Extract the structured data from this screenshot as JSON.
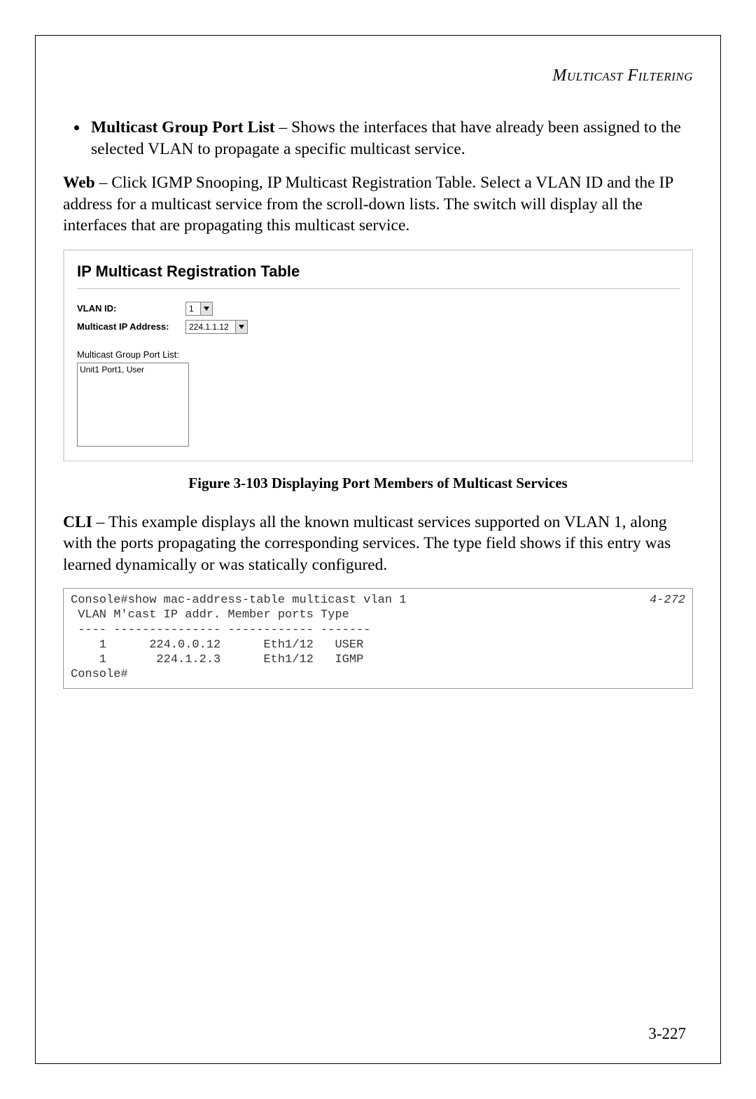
{
  "header": {
    "section_title": "Multicast Filtering"
  },
  "bullet": {
    "term": "Multicast Group Port List",
    "desc": " – Shows the interfaces that have already been assigned to the selected VLAN to propagate a specific multicast service."
  },
  "web_para": {
    "lead": "Web",
    "rest": " – Click IGMP Snooping, IP Multicast Registration Table. Select a VLAN ID and the IP address for a multicast service from the scroll-down lists. The switch will display all the interfaces that are propagating this multicast service."
  },
  "ui": {
    "title": "IP Multicast Registration Table",
    "vlan_label": "VLAN ID:",
    "vlan_value": "1",
    "ip_label": "Multicast IP Address:",
    "ip_value": "224.1.1.12",
    "portlist_label": "Multicast Group Port List:",
    "portlist_item": "Unit1 Port1, User"
  },
  "figure_caption": "Figure 3-103  Displaying Port Members of Multicast Services",
  "cli_para": {
    "lead": "CLI",
    "rest": " – This example displays all the known multicast services supported on VLAN 1, along with the ports propagating the corresponding services. The type field shows if this entry was learned dynamically or was statically configured."
  },
  "cli": {
    "ref": "4-272",
    "line1": "Console#show mac-address-table multicast vlan 1",
    "line2": " VLAN M'cast IP addr. Member ports Type",
    "line3": " ---- --------------- ------------ -------",
    "line4": "    1      224.0.0.12      Eth1/12   USER",
    "line5": "    1       224.1.2.3      Eth1/12   IGMP",
    "line6": "Console#"
  },
  "page_number": "3-227"
}
